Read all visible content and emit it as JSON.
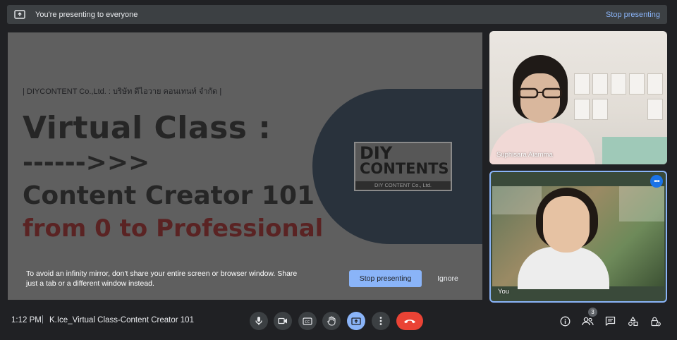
{
  "banner": {
    "message": "You're presenting to everyone",
    "stop_link": "Stop presenting"
  },
  "slide": {
    "org_line": "| DIYCONTENT Co.,Ltd. : บริษัท ดีไอวาย คอนเทนท์ จำกัด |",
    "title_line1": "Virtual Class :",
    "title_line2": "------>>>",
    "title_line3": "Content Creator 101",
    "title_line4": "from 0 to Professional",
    "logo_line1": "DIY",
    "logo_line2": "CONTENTS",
    "logo_line3": "DIY CONTENT Co., Ltd."
  },
  "warning": {
    "text": "To avoid an infinity mirror, don't share your entire screen or browser window. Share just a tab or a different window instead.",
    "stop_button": "Stop presenting",
    "ignore_button": "Ignore"
  },
  "participants": [
    {
      "name": "Suphisara Aiamma"
    },
    {
      "name": "You"
    }
  ],
  "bottom": {
    "time": "1:12 PM",
    "separator": "|",
    "meeting_title": "K.Ice_Virtual Class-Content Creator 101",
    "people_count": "3"
  },
  "icons": {
    "present": "present-to-all-icon",
    "mic": "mic-icon",
    "camera": "videocam-icon",
    "captions": "closed-captions-icon",
    "raise_hand": "raise-hand-icon",
    "more": "more-vert-icon",
    "leave": "call-end-icon",
    "info": "info-icon",
    "people": "people-icon",
    "chat": "chat-icon",
    "activities": "activities-icon",
    "host_controls": "host-controls-icon"
  },
  "colors": {
    "accent": "#8ab4f8",
    "leave": "#ea4335",
    "background": "#202124"
  }
}
